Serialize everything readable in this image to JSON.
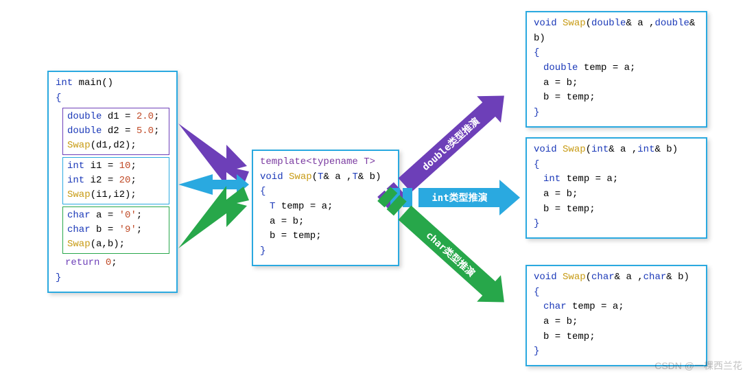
{
  "colors": {
    "purple": "#6d3fb8",
    "blue": "#2aa9e0",
    "green": "#27a74a"
  },
  "main": {
    "sig_type": "int",
    "sig_name": " main",
    "sig_paren": "()",
    "open": "{",
    "close": "}",
    "block_double": {
      "l1_t": "double",
      "l1_r": " d1 ",
      "l1_eq": "= ",
      "l1_n": "2.0",
      "l1_end": ";",
      "l2_t": "double",
      "l2_r": " d2 ",
      "l2_eq": "= ",
      "l2_n": "5.0",
      "l2_end": ";",
      "l3_fn": "Swap",
      "l3_args": "(d1,d2);"
    },
    "block_int": {
      "l1_t": "int",
      "l1_r": " i1 ",
      "l1_eq": "= ",
      "l1_n": "10",
      "l1_end": ";",
      "l2_t": "int",
      "l2_r": " i2 ",
      "l2_eq": "= ",
      "l2_n": "20",
      "l2_end": ";",
      "l3_fn": "Swap",
      "l3_args": "(i1,i2);"
    },
    "block_char": {
      "l1_t": "char",
      "l1_r": " a ",
      "l1_eq": "= ",
      "l1_n": "'0'",
      "l1_end": ";",
      "l2_t": "char",
      "l2_r": " b ",
      "l2_eq": "= ",
      "l2_n": "'9'",
      "l2_end": ";",
      "l3_fn": "Swap",
      "l3_args": "(a,b);"
    },
    "ret_kw": "return",
    "ret_sp": " ",
    "ret_n": "0",
    "ret_end": ";"
  },
  "template": {
    "decl": "template",
    "decl2": "<typename T>",
    "sig_t": "void",
    "sig_fn": " Swap",
    "sig_paren_l": "(",
    "sig_p1_t": "T",
    "sig_p1_r": "& a ,",
    "sig_p2_t": "T",
    "sig_p2_r": "& b)",
    "open": "{",
    "close": "}",
    "body1_t": "T",
    "body1_r": " temp = a;",
    "body2": "a = b;",
    "body3": "b = temp;"
  },
  "double_fn": {
    "sig_t": "void",
    "sig_fn": " Swap",
    "sig_paren_l": "(",
    "sig_p1_t": "double",
    "sig_p1_r": "& a ,",
    "sig_p2_t": "double",
    "sig_p2_r": "& b)",
    "open": "{",
    "close": "}",
    "body1_t": "double",
    "body1_r": " temp = a;",
    "body2": "a = b;",
    "body3": "b = temp;"
  },
  "int_fn": {
    "sig_t": "void",
    "sig_fn": " Swap",
    "sig_paren_l": "(",
    "sig_p1_t": "int",
    "sig_p1_r": "& a ,",
    "sig_p2_t": "int",
    "sig_p2_r": "& b)",
    "open": "{",
    "close": "}",
    "body1_t": "int",
    "body1_r": " temp = a;",
    "body2": "a = b;",
    "body3": "b = temp;"
  },
  "char_fn": {
    "sig_t": "void",
    "sig_fn": " Swap",
    "sig_paren_l": "(",
    "sig_p1_t": "char",
    "sig_p1_r": "& a ,",
    "sig_p2_t": "char",
    "sig_p2_r": "& b)",
    "open": "{",
    "close": "}",
    "body1_t": "char",
    "body1_r": " temp = a;",
    "body2": "a = b;",
    "body3": "b = temp;"
  },
  "arrows": {
    "double_label": "double类型推演",
    "int_label": "int类型推演",
    "char_label": "char类型推演"
  },
  "watermark": "CSDN @一棵西兰花"
}
